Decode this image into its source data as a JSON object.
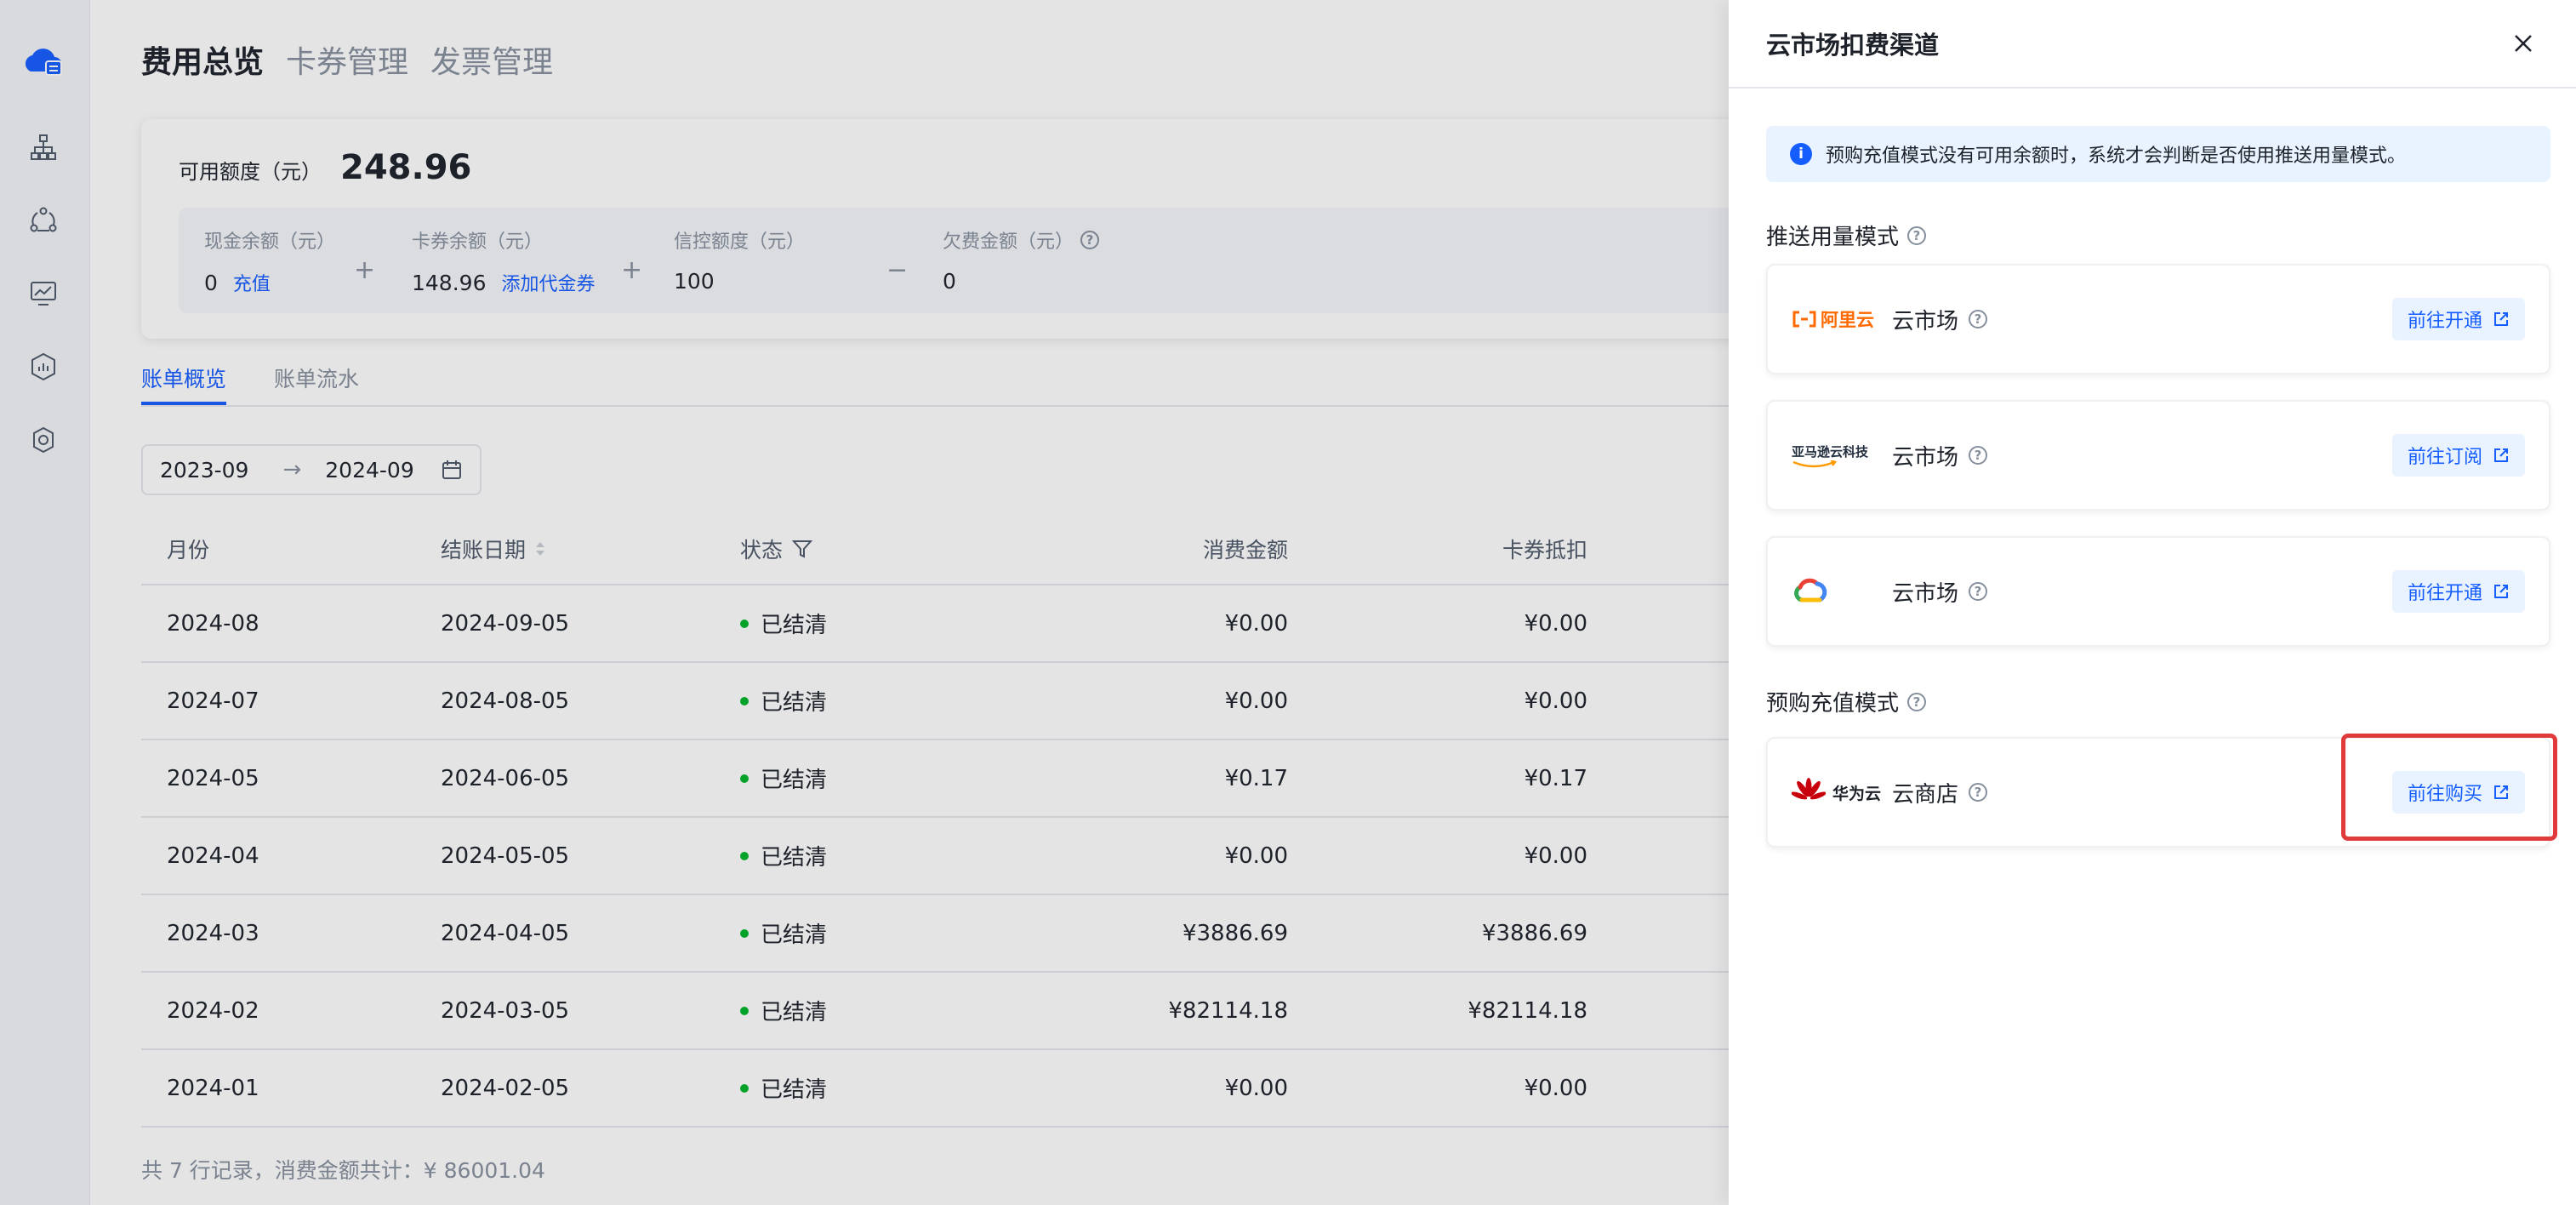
{
  "header": {
    "tabs": [
      {
        "label": "费用总览",
        "active": true
      },
      {
        "label": "卡券管理",
        "active": false
      },
      {
        "label": "发票管理",
        "active": false
      }
    ]
  },
  "nav": {
    "icons": [
      "cloud-logo-icon",
      "network-icon",
      "cluster-icon",
      "monitor-icon",
      "report-icon",
      "settings-icon"
    ]
  },
  "summary": {
    "available_label": "可用额度（元）",
    "available_value": "248.96",
    "cash": {
      "label": "现金余额（元）",
      "value": "0",
      "link": "充值"
    },
    "coupon": {
      "label": "卡券余额（元）",
      "value": "148.96",
      "link": "添加代金券"
    },
    "credit": {
      "label": "信控额度（元）",
      "value": "100"
    },
    "arrears": {
      "label": "欠费金额（元）",
      "value": "0"
    },
    "op_plus": "+",
    "op_minus": "−"
  },
  "sub_tabs": [
    {
      "label": "账单概览",
      "active": true
    },
    {
      "label": "账单流水",
      "active": false
    }
  ],
  "date_range": {
    "start": "2023-09",
    "arrow": "→",
    "end": "2024-09"
  },
  "table": {
    "headers": [
      "月份",
      "结账日期",
      "状态",
      "消费金额",
      "卡券抵扣"
    ],
    "rows": [
      [
        "2024-08",
        "2024-09-05",
        "已结清",
        "¥0.00",
        "¥0.00"
      ],
      [
        "2024-07",
        "2024-08-05",
        "已结清",
        "¥0.00",
        "¥0.00"
      ],
      [
        "2024-05",
        "2024-06-05",
        "已结清",
        "¥0.17",
        "¥0.17"
      ],
      [
        "2024-04",
        "2024-05-05",
        "已结清",
        "¥0.00",
        "¥0.00"
      ],
      [
        "2024-03",
        "2024-04-05",
        "已结清",
        "¥3886.69",
        "¥3886.69"
      ],
      [
        "2024-02",
        "2024-03-05",
        "已结清",
        "¥82114.18",
        "¥82114.18"
      ],
      [
        "2024-01",
        "2024-02-05",
        "已结清",
        "¥0.00",
        "¥0.00"
      ]
    ],
    "footer": "共 7 行记录，消费金额共计：¥ 86001.04"
  },
  "drawer": {
    "title": "云市场扣费渠道",
    "info": "预购充值模式没有可用余额时，系统才会判断是否使用推送用量模式。",
    "push_section": "推送用量模式",
    "prepaid_section": "预购充值模式",
    "channels": [
      {
        "logo_text": "阿里云",
        "name": "云市场",
        "button": "前往开通"
      },
      {
        "logo_text": "亚马逊云科技",
        "name": "云市场",
        "button": "前往订阅"
      },
      {
        "logo_text": "",
        "name": "云市场",
        "button": "前往开通"
      },
      {
        "logo_text": "华为云",
        "name": "云商店",
        "button": "前往购买"
      }
    ]
  },
  "colors": {
    "primary": "#165dff",
    "success": "#00b42a",
    "highlight": "#e03a3a",
    "aliyun": "#ff6a00",
    "huawei": "#c7000b"
  }
}
